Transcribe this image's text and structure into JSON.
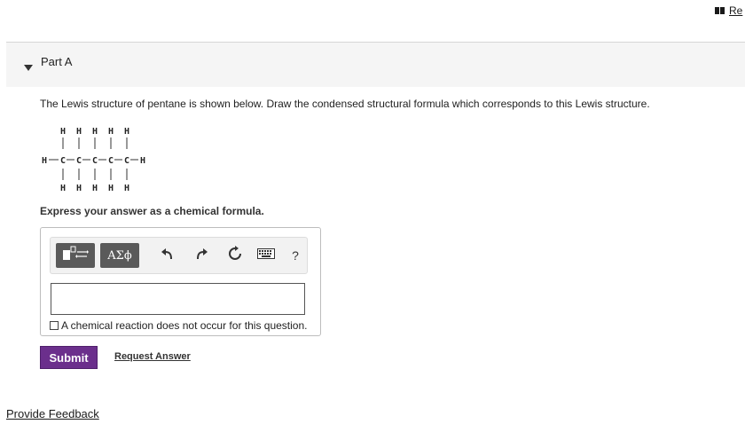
{
  "top_link": {
    "icon": "book-icon",
    "label": "Re"
  },
  "part": {
    "caret_icon": "caret-down-icon",
    "title": "Part A"
  },
  "question": {
    "text": "The Lewis structure of pentane is shown below. Draw the condensed structural formula which corresponds to this Lewis structure."
  },
  "lewis_structure": {
    "top_row": [
      "H",
      "H",
      "H",
      "H",
      "H"
    ],
    "middle_row": [
      "H",
      "C",
      "C",
      "C",
      "C",
      "C",
      "H"
    ],
    "bottom_row": [
      "H",
      "H",
      "H",
      "H",
      "H"
    ]
  },
  "instructions": "Express your answer as a chemical formula.",
  "toolbar": {
    "template_icon": "template-icon",
    "symbols_label": "ΑΣϕ",
    "undo_icon": "undo-icon",
    "redo_icon": "redo-icon",
    "reset_icon": "reset-icon",
    "keyboard_icon": "keyboard-icon",
    "help_label": "?"
  },
  "answer": {
    "value": "",
    "no_reaction_label": "A chemical reaction does not occur for this question."
  },
  "buttons": {
    "submit": "Submit",
    "request_answer": "Request Answer"
  },
  "footer": {
    "feedback": "Provide Feedback"
  },
  "colors": {
    "submit_bg": "#6b2f8c",
    "header_bg": "#f5f5f5",
    "toolbar_btn": "#5a5a5a"
  }
}
